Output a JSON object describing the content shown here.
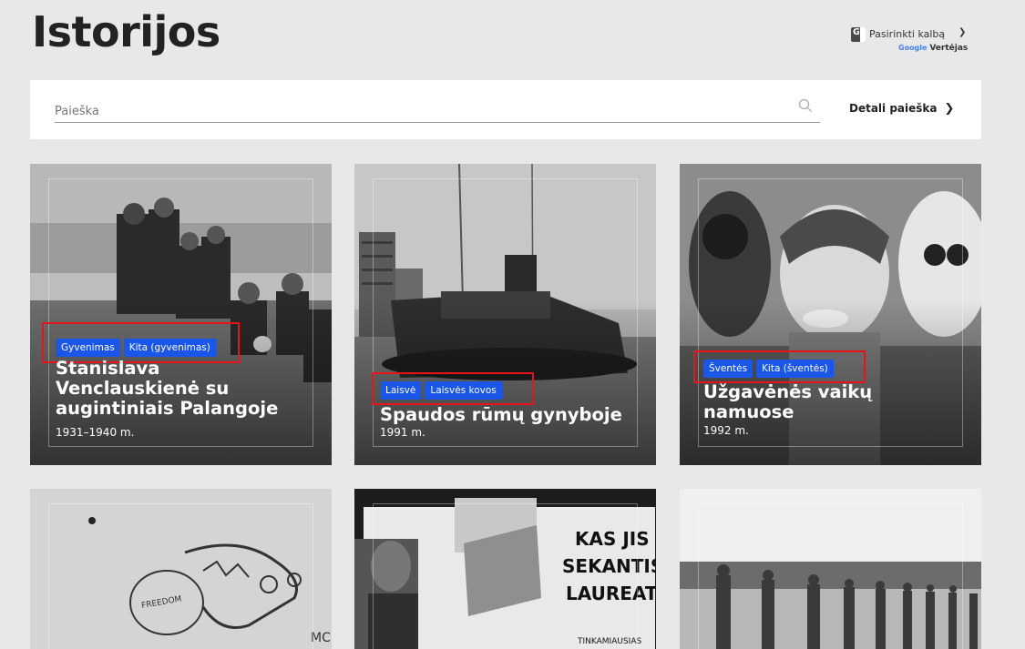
{
  "page": {
    "title": "Istorijos"
  },
  "translate": {
    "label": "Pasirinkti kalbą",
    "powered_by": "Google",
    "powered_suffix": "Vertėjas"
  },
  "search": {
    "placeholder": "Paieška",
    "detail_label": "Detali paieška"
  },
  "cards": [
    {
      "title_lines": [
        "Stanislava",
        "Venclauskienė su",
        "augintiniais Palangoje"
      ],
      "year": "1931–1940 m.",
      "tags": [
        "Gyvenimas",
        "Kita (gyvenimas)"
      ]
    },
    {
      "title_lines": [
        "Spaudos rūmų gynyboje"
      ],
      "year": "1991 m.",
      "tags": [
        "Laisvė",
        "Laisvės kovos"
      ]
    },
    {
      "title_lines": [
        "Užgavėnės vaikų",
        "namuose"
      ],
      "year": "1992 m.",
      "tags": [
        "Šventės",
        "Kita (šventės)"
      ]
    },
    {
      "graffiti": "FREEDOM",
      "graffiti_partial": "MC"
    },
    {
      "poster_lines": [
        "KAS JIS",
        "SEKANTIS",
        "LAUREATI",
        "TINKAMIAUSIAS"
      ]
    },
    {}
  ]
}
